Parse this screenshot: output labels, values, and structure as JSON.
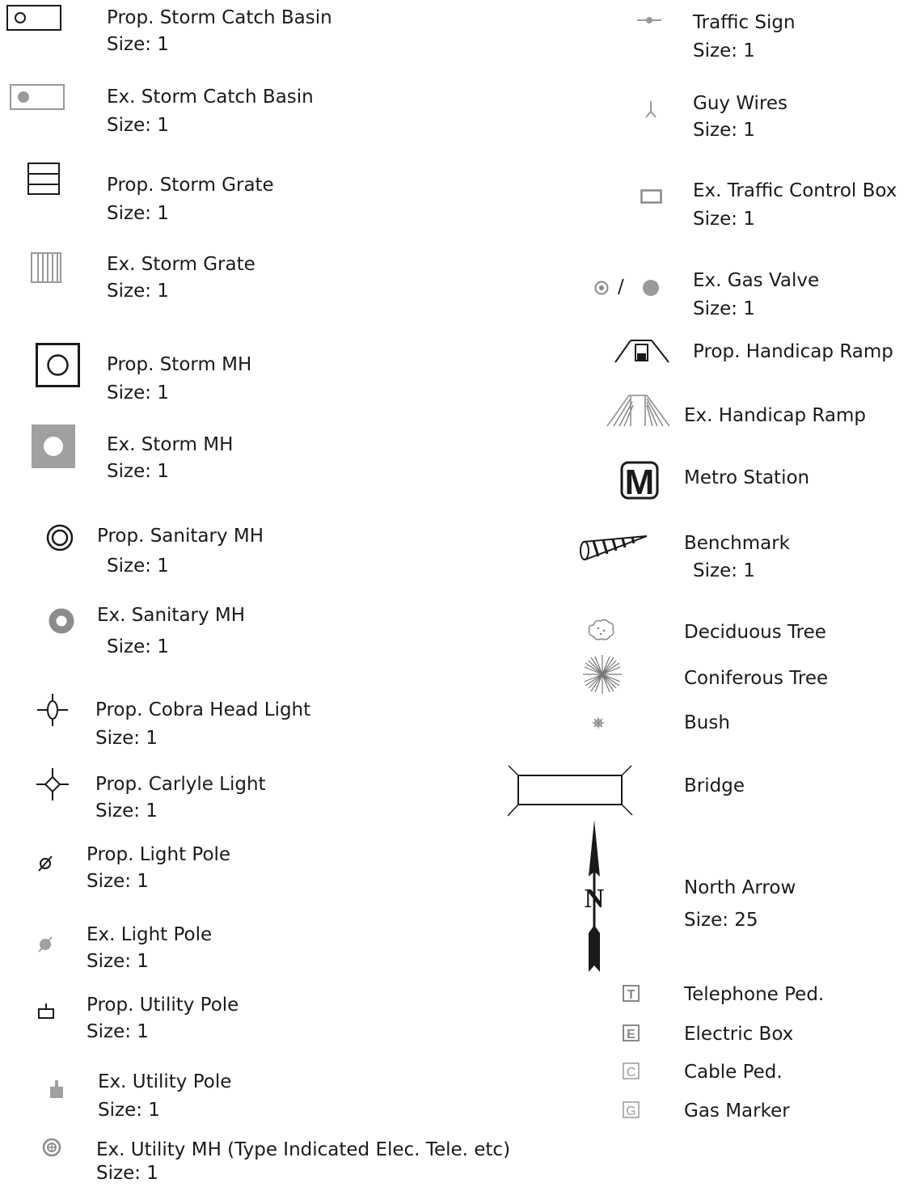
{
  "left_column": [
    {
      "id": "prop-storm-catch-basin",
      "name": "Prop. Storm Catch Basin",
      "size": "Size: 1",
      "icon": "prop-storm-catch-basin-icon"
    },
    {
      "id": "ex-storm-catch-basin",
      "name": "Ex. Storm Catch Basin",
      "size": "Size: 1",
      "icon": "ex-storm-catch-basin-icon"
    },
    {
      "id": "prop-storm-grate",
      "name": "Prop. Storm Grate",
      "size": "Size: 1",
      "icon": "prop-storm-grate-icon"
    },
    {
      "id": "ex-storm-grate",
      "name": "Ex. Storm Grate",
      "size": "Size: 1",
      "icon": "ex-storm-grate-icon"
    },
    {
      "id": "prop-storm-mh",
      "name": "Prop. Storm MH",
      "size": "Size: 1",
      "icon": "prop-storm-mh-icon"
    },
    {
      "id": "ex-storm-mh",
      "name": "Ex. Storm MH",
      "size": "Size: 1",
      "icon": "ex-storm-mh-icon"
    },
    {
      "id": "prop-sanitary-mh",
      "name": "Prop. Sanitary MH",
      "size": "Size: 1",
      "icon": "prop-sanitary-mh-icon"
    },
    {
      "id": "ex-sanitary-mh",
      "name": "Ex. Sanitary MH",
      "size": "Size: 1",
      "icon": "ex-sanitary-mh-icon"
    },
    {
      "id": "prop-cobra-head-light",
      "name": "Prop. Cobra Head Light",
      "size": "Size: 1",
      "icon": "cobra-head-light-icon"
    },
    {
      "id": "prop-carlyle-light",
      "name": "Prop. Carlyle Light",
      "size": "Size: 1",
      "icon": "carlyle-light-icon"
    },
    {
      "id": "prop-light-pole",
      "name": "Prop. Light Pole",
      "size": "Size: 1",
      "icon": "prop-light-pole-icon"
    },
    {
      "id": "ex-light-pole",
      "name": "Ex. Light Pole",
      "size": "Size: 1",
      "icon": "ex-light-pole-icon"
    },
    {
      "id": "prop-utility-pole",
      "name": "Prop. Utility Pole",
      "size": "Size: 1",
      "icon": "prop-utility-pole-icon"
    },
    {
      "id": "ex-utility-pole",
      "name": "Ex. Utility Pole",
      "size": "Size: 1",
      "icon": "ex-utility-pole-icon"
    },
    {
      "id": "ex-utility-mh",
      "name": "Ex. Utility MH (Type Indicated Elec. Tele. etc)",
      "size": "Size: 1",
      "icon": "ex-utility-mh-icon"
    }
  ],
  "right_column": [
    {
      "id": "traffic-sign",
      "name": "Traffic Sign",
      "size": "Size: 1",
      "icon": "traffic-sign-icon"
    },
    {
      "id": "guy-wires",
      "name": "Guy Wires",
      "size": "Size: 1",
      "icon": "guy-wires-icon"
    },
    {
      "id": "ex-traffic-control-box",
      "name": "Ex. Traffic Control Box",
      "size": "Size: 1",
      "icon": "traffic-control-box-icon"
    },
    {
      "id": "ex-gas-valve",
      "name": "Ex. Gas Valve",
      "size": "Size: 1",
      "icon": "gas-valve-icon",
      "separator": "/"
    },
    {
      "id": "prop-handicap-ramp",
      "name": "Prop. Handicap Ramp",
      "icon": "prop-handicap-ramp-icon"
    },
    {
      "id": "ex-handicap-ramp",
      "name": "Ex. Handicap Ramp",
      "icon": "ex-handicap-ramp-icon"
    },
    {
      "id": "metro-station",
      "name": "Metro Station",
      "icon": "metro-station-icon",
      "glyph": "M"
    },
    {
      "id": "benchmark",
      "name": "Benchmark",
      "size": "Size: 1",
      "icon": "benchmark-icon"
    },
    {
      "id": "deciduous-tree",
      "name": "Deciduous Tree",
      "icon": "deciduous-tree-icon"
    },
    {
      "id": "coniferous-tree",
      "name": "Coniferous Tree",
      "icon": "coniferous-tree-icon"
    },
    {
      "id": "bush",
      "name": "Bush",
      "icon": "bush-icon"
    },
    {
      "id": "bridge",
      "name": "Bridge",
      "icon": "bridge-icon"
    },
    {
      "id": "north-arrow",
      "name": "North Arrow",
      "size": "Size: 25",
      "icon": "north-arrow-icon",
      "glyph": "N"
    },
    {
      "id": "telephone-ped",
      "name": "Telephone Ped.",
      "icon": "telephone-ped-icon",
      "glyph": "T"
    },
    {
      "id": "electric-box",
      "name": "Electric Box",
      "icon": "electric-box-icon",
      "glyph": "E"
    },
    {
      "id": "cable-ped",
      "name": "Cable Ped.",
      "icon": "cable-ped-icon",
      "glyph": "C"
    },
    {
      "id": "gas-marker",
      "name": "Gas Marker",
      "icon": "gas-marker-icon",
      "glyph": "G"
    }
  ]
}
